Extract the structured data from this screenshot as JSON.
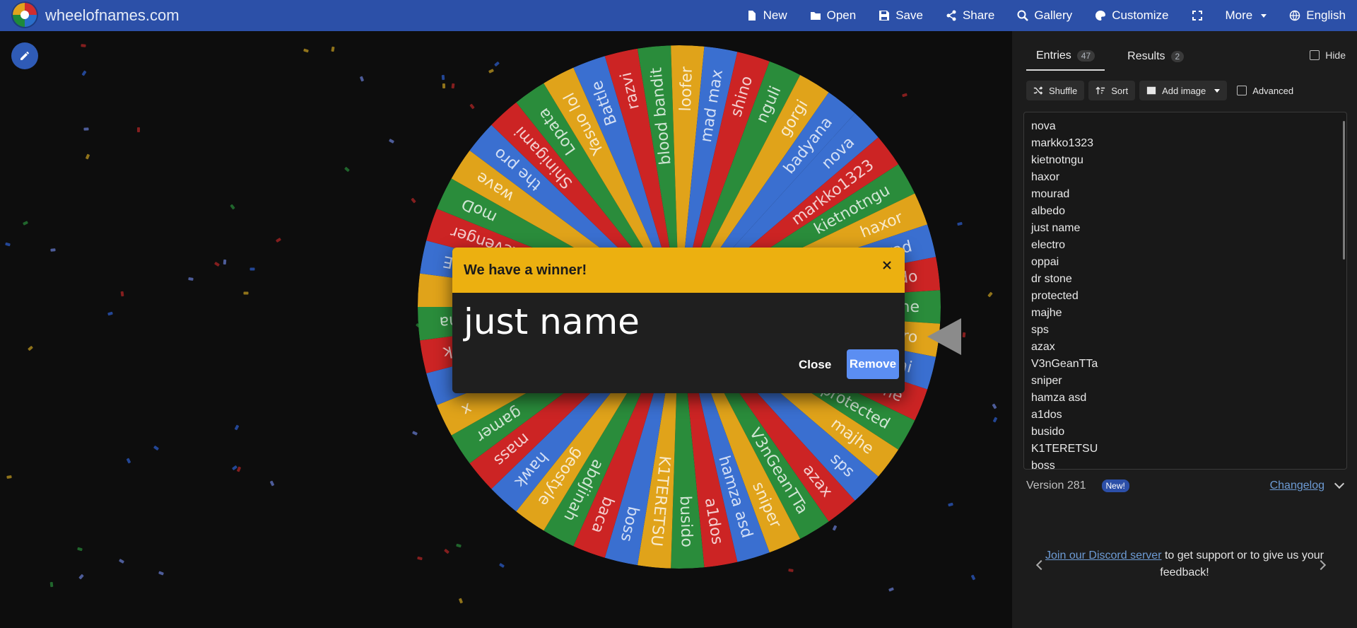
{
  "header": {
    "site_title": "wheelofnames.com",
    "nav": [
      {
        "label": "New",
        "icon": "file-icon"
      },
      {
        "label": "Open",
        "icon": "folder-open-icon"
      },
      {
        "label": "Save",
        "icon": "save-icon"
      },
      {
        "label": "Share",
        "icon": "share-icon"
      },
      {
        "label": "Gallery",
        "icon": "search-icon"
      },
      {
        "label": "Customize",
        "icon": "palette-icon"
      },
      {
        "label": "",
        "icon": "fullscreen-icon"
      },
      {
        "label": "More",
        "icon": "chevron-down-icon"
      },
      {
        "label": "English",
        "icon": "globe-icon"
      }
    ]
  },
  "wheel": {
    "slices": [
      "nova",
      "markko1323",
      "kietnotngu",
      "haxor",
      "mourad",
      "albedo",
      "just name",
      "electro",
      "oppai",
      "dr stone",
      "protected",
      "majhe",
      "sps",
      "azax",
      "V3nGeanTTa",
      "sniper",
      "hamza asd",
      "a1dos",
      "busido",
      "K1TERETSU",
      "boss",
      "baca",
      "abdjinah",
      "geostyle",
      "hawk",
      "mass",
      "gamer",
      "x",
      "",
      "chink",
      "lasina",
      "",
      "BOAE",
      "The Revenger",
      "moD",
      "wave",
      "the pro",
      "Shinigami",
      "Lopata",
      "Yasuo lol",
      "Battle",
      "razvi",
      "blood bandit",
      "loofer",
      "mad max",
      "shino",
      "nguli",
      "gorgi",
      "badyana"
    ],
    "colors": [
      "#3a6fd0",
      "#cc2424",
      "#2a8c3b",
      "#e0a31a"
    ]
  },
  "dialog": {
    "title": "We have a winner!",
    "winner": "just name",
    "close_label": "Close",
    "remove_label": "Remove"
  },
  "panel": {
    "tabs": [
      {
        "label": "Entries",
        "count": "47"
      },
      {
        "label": "Results",
        "count": "2"
      }
    ],
    "hide_label": "Hide",
    "tools": {
      "shuffle": "Shuffle",
      "sort": "Sort",
      "add_image": "Add image",
      "advanced": "Advanced"
    },
    "entries": [
      "nova",
      "markko1323",
      "kietnotngu",
      "haxor",
      "mourad",
      "albedo",
      "just name",
      "electro",
      "oppai",
      "dr stone",
      "protected",
      "majhe",
      "sps",
      "azax",
      "V3nGeanTTa",
      "sniper",
      "hamza asd",
      "a1dos",
      "busido",
      "K1TERETSU",
      "boss"
    ],
    "version": "Version 281",
    "new_badge": "New!",
    "changelog": "Changelog",
    "footer": {
      "link": "Join our Discord server",
      "text": " to get support or to give us your feedback!"
    }
  }
}
